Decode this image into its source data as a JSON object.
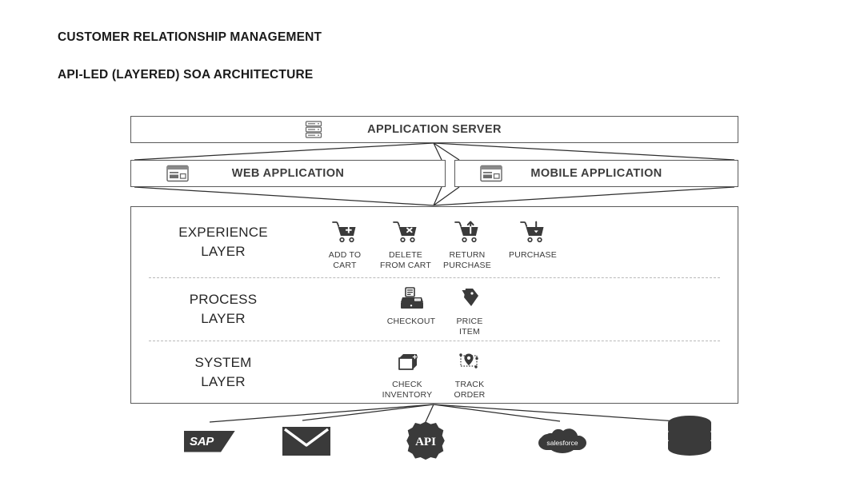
{
  "titles": {
    "line1": "CUSTOMER RELATIONSHIP MANAGEMENT",
    "line2_bold": "API-LED (LAYERED)",
    "line2_rest": " SOA ARCHITECTURE"
  },
  "top_tier": {
    "app_server": {
      "label": "APPLICATION SERVER",
      "icon": "server-rack-icon"
    },
    "web_app": {
      "label": "WEB APPLICATION",
      "icon": "browser-window-icon"
    },
    "mobile_app": {
      "label": "MOBILE APPLICATION",
      "icon": "browser-window-icon"
    }
  },
  "layers": [
    {
      "id": "experience",
      "name_line1": "EXPERIENCE",
      "name_line2": "LAYER",
      "nodes": [
        {
          "icon": "cart-add-icon",
          "cap_line1": "ADD TO",
          "cap_line2": "CART"
        },
        {
          "icon": "cart-delete-icon",
          "cap_line1": "DELETE",
          "cap_line2": "FROM CART"
        },
        {
          "icon": "cart-return-icon",
          "cap_line1": "RETURN",
          "cap_line2": "PURCHASE"
        },
        {
          "icon": "cart-purchase-icon",
          "cap_line1": "PURCHASE",
          "cap_line2": ""
        }
      ]
    },
    {
      "id": "process",
      "name_line1": "PROCESS",
      "name_line2": "LAYER",
      "nodes": [
        {
          "icon": "cash-register-icon",
          "cap_line1": "CHECKOUT",
          "cap_line2": ""
        },
        {
          "icon": "price-tag-icon",
          "cap_line1": "PRICE",
          "cap_line2": "ITEM"
        }
      ]
    },
    {
      "id": "system",
      "name_line1": "SYSTEM",
      "name_line2": "LAYER",
      "nodes": [
        {
          "icon": "open-box-icon",
          "cap_line1": "CHECK",
          "cap_line2": "INVENTORY"
        },
        {
          "icon": "map-route-icon",
          "cap_line1": "TRACK",
          "cap_line2": "ORDER"
        }
      ]
    }
  ],
  "backends": [
    {
      "icon": "sap-logo-icon",
      "label": "SAP"
    },
    {
      "icon": "envelope-icon",
      "label": ""
    },
    {
      "icon": "api-gear-icon",
      "label": "API"
    },
    {
      "icon": "salesforce-cloud-icon",
      "label": "salesforce"
    },
    {
      "icon": "database-icon",
      "label": ""
    }
  ],
  "colors": {
    "icon_dark": "#3a3a3a",
    "border": "#5a5a5a",
    "text": "#404040",
    "divider": "#b9b9b9",
    "background": "#ffffff"
  }
}
